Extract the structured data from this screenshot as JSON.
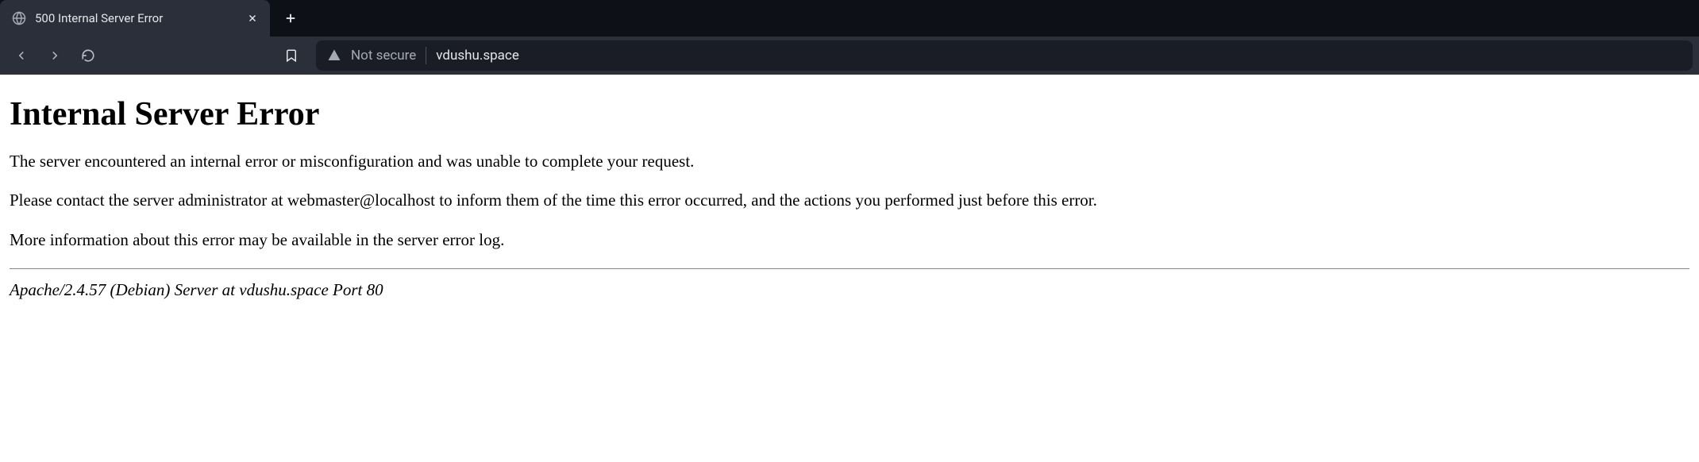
{
  "tab": {
    "title": "500 Internal Server Error"
  },
  "address": {
    "security_label": "Not secure",
    "url": "vdushu.space"
  },
  "page": {
    "heading": "Internal Server Error",
    "para1": "The server encountered an internal error or misconfiguration and was unable to complete your request.",
    "para2": "Please contact the server administrator at webmaster@localhost to inform them of the time this error occurred, and the actions you performed just before this error.",
    "para3": "More information about this error may be available in the server error log.",
    "footer": "Apache/2.4.57 (Debian) Server at vdushu.space Port 80"
  }
}
